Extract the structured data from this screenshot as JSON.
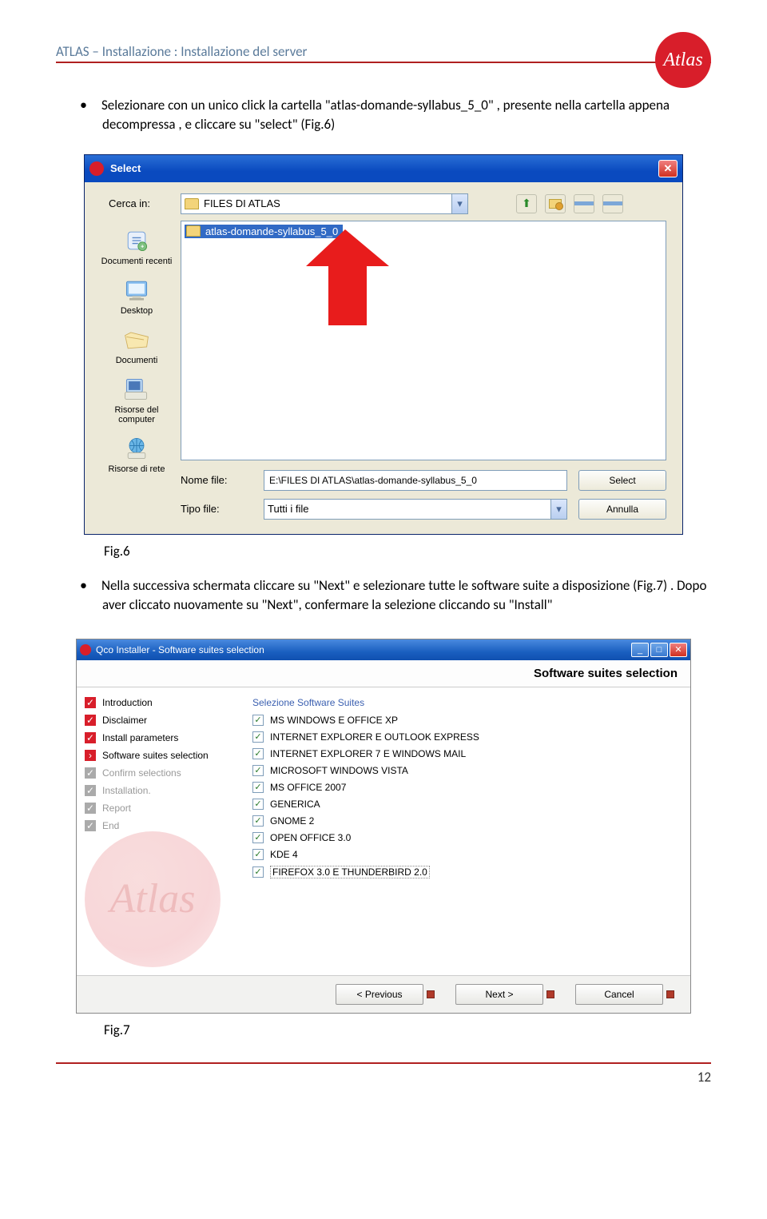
{
  "doc": {
    "header": "ATLAS – Installazione : Installazione del server",
    "logo_text": "Atlas",
    "bullet1": "Selezionare con un unico click la cartella \"atlas-domande-syllabus_5_0\" , presente nella cartella appena decompressa , e cliccare su \"select\" (Fig.6)",
    "fig6_caption": "Fig.6",
    "bullet2": "Nella successiva schermata cliccare su \"Next\" e selezionare tutte le software suite a disposizione (Fig.7) . Dopo aver cliccato nuovamente su \"Next\", confermare la selezione cliccando su \"Install\"",
    "fig7_caption": "Fig.7",
    "page_number": "12"
  },
  "dialog1": {
    "title": "Select",
    "look_in_label": "Cerca in:",
    "look_in_value": "FILES DI ATLAS",
    "selected_folder": "atlas-domande-syllabus_5_0",
    "shortcuts": [
      "Documenti recenti",
      "Desktop",
      "Documenti",
      "Risorse del computer",
      "Risorse di rete"
    ],
    "filename_label": "Nome file:",
    "filename_value": "E:\\FILES DI ATLAS\\atlas-domande-syllabus_5_0",
    "filetype_label": "Tipo file:",
    "filetype_value": "Tutti i file",
    "select_btn": "Select",
    "cancel_btn": "Annulla"
  },
  "dialog2": {
    "title": "Qco Installer - Software suites selection",
    "heading": "Software suites selection",
    "section_title": "Selezione Software Suites",
    "steps": [
      {
        "label": "Introduction",
        "state": "done"
      },
      {
        "label": "Disclaimer",
        "state": "done"
      },
      {
        "label": "Install parameters",
        "state": "done"
      },
      {
        "label": "Software suites selection",
        "state": "current"
      },
      {
        "label": "Confirm selections",
        "state": "pending"
      },
      {
        "label": "Installation.",
        "state": "pending"
      },
      {
        "label": "Report",
        "state": "pending"
      },
      {
        "label": "End",
        "state": "pending"
      }
    ],
    "suites": [
      "MS WINDOWS E OFFICE XP",
      "INTERNET EXPLORER E OUTLOOK EXPRESS",
      "INTERNET EXPLORER 7 E WINDOWS MAIL",
      "MICROSOFT WINDOWS VISTA",
      "MS OFFICE 2007",
      "GENERICA",
      "GNOME 2",
      "OPEN OFFICE 3.0",
      "KDE 4",
      "FIREFOX 3.0 E THUNDERBIRD 2.0"
    ],
    "previous_btn": "< Previous",
    "next_btn": "Next >",
    "cancel_btn": "Cancel"
  }
}
